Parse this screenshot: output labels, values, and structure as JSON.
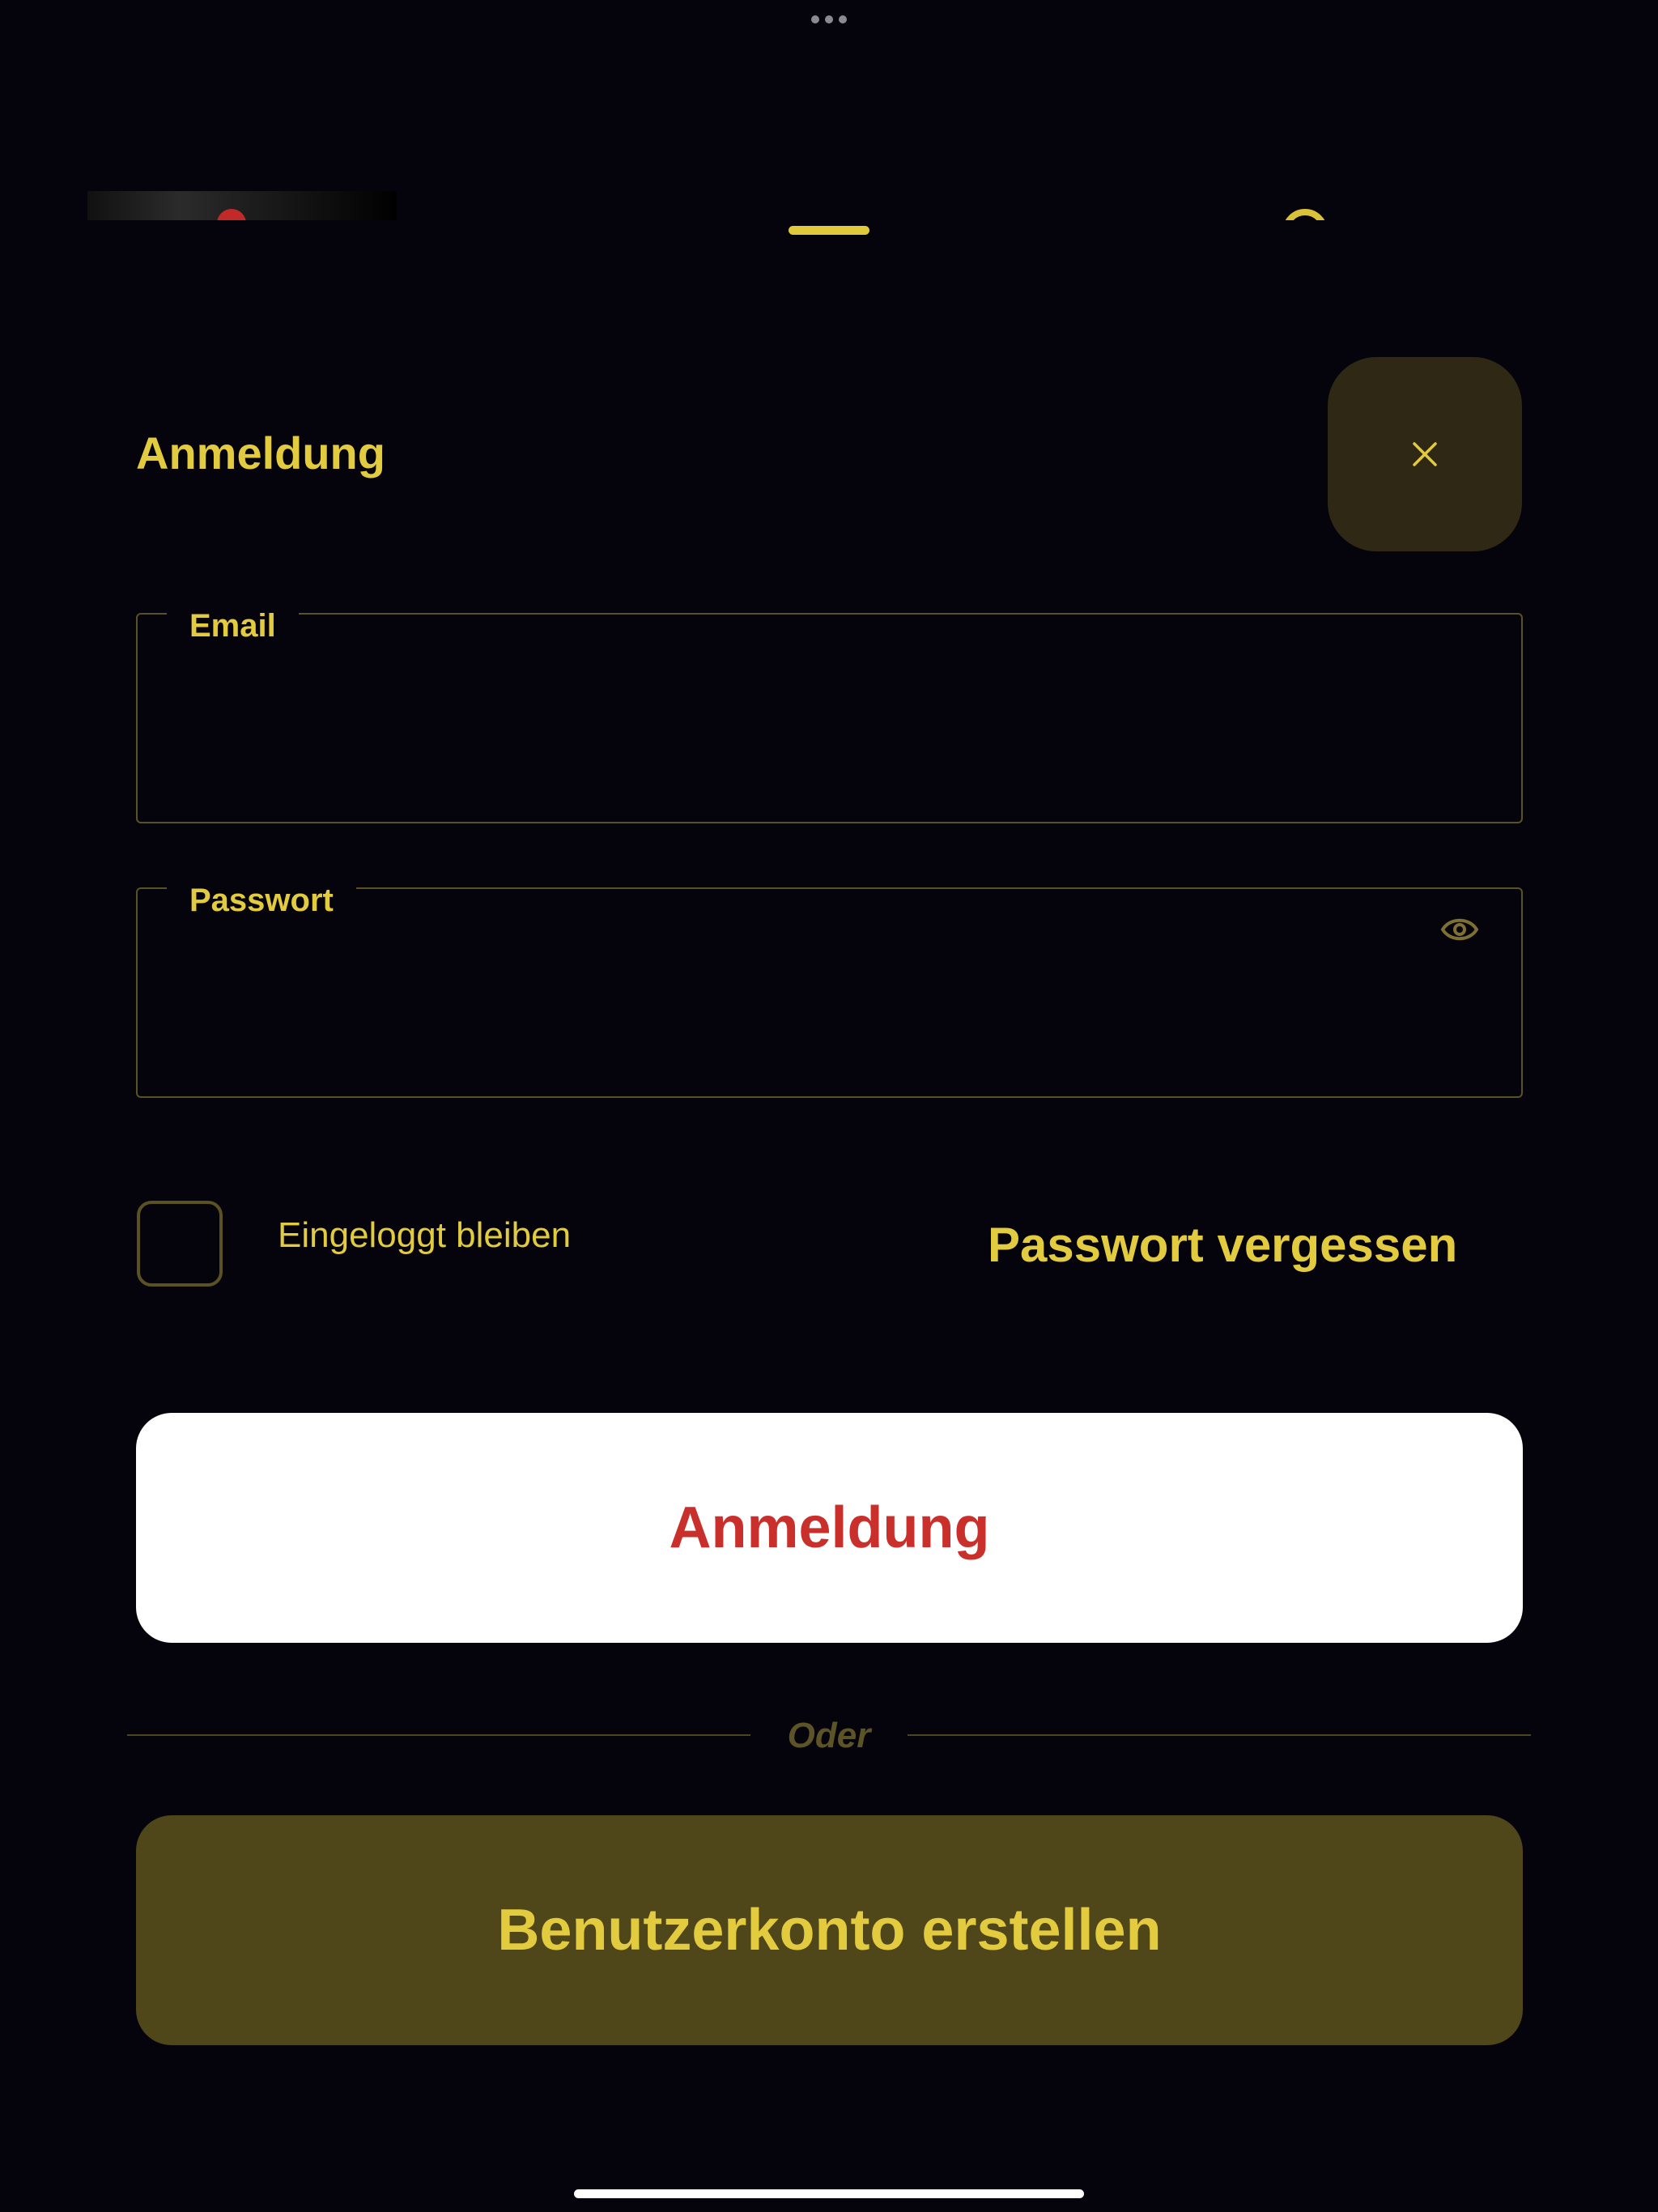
{
  "colors": {
    "background": "#05040c",
    "accent_yellow": "#e3cb3f",
    "field_border": "#5a5220",
    "close_button_bg": "#2e2814",
    "login_button_bg": "#ffffff",
    "login_button_text": "#c9302c",
    "register_button_bg": "#4f461a",
    "divider_text": "#5c5426"
  },
  "sheet": {
    "title": "Anmeldung",
    "close_icon": "close-icon"
  },
  "form": {
    "email": {
      "label": "Email",
      "value": "",
      "placeholder": ""
    },
    "password": {
      "label": "Passwort",
      "value": "",
      "placeholder": "",
      "toggle_icon": "eye-icon"
    },
    "remember_me": {
      "label": "Eingeloggt bleiben",
      "checked": false
    },
    "forgot_password_label": "Passwort vergessen",
    "login_button_label": "Anmeldung",
    "divider_label": "Oder",
    "register_button_label": "Benutzerkonto erstellen"
  }
}
